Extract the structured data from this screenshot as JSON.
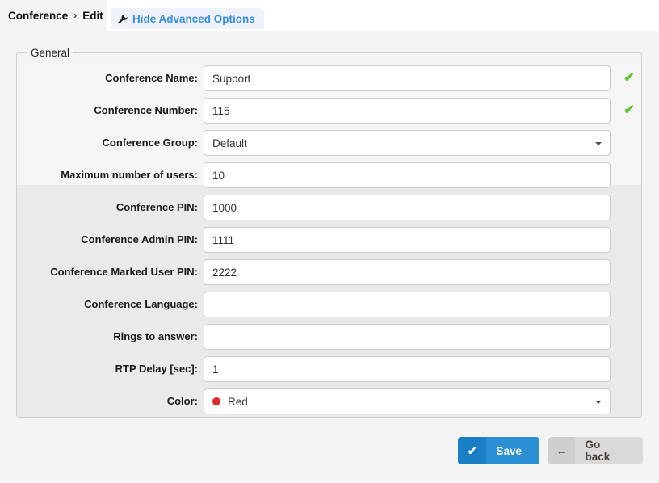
{
  "topbar": {
    "breadcrumb": [
      "Conference",
      "Edit"
    ],
    "breadcrumb_separator": "›",
    "advanced_tab": {
      "label": "Hide Advanced Options",
      "icon": "wrench-icon",
      "color": "#3b8ede",
      "background": "#eef2fb"
    }
  },
  "fieldset": {
    "legend": "General"
  },
  "fields": [
    {
      "label": "Conference Name:",
      "value": "Support",
      "type": "text",
      "valid": true,
      "section": "basic"
    },
    {
      "label": "Conference Number:",
      "value": "115",
      "type": "text",
      "valid": true,
      "section": "basic"
    },
    {
      "label": "Conference Group:",
      "value": "Default",
      "type": "select",
      "valid": false,
      "section": "basic"
    },
    {
      "label": "Maximum number of users:",
      "value": "10",
      "type": "text",
      "valid": false,
      "section": "advanced"
    },
    {
      "label": "Conference PIN:",
      "value": "1000",
      "type": "text",
      "valid": false,
      "section": "advanced"
    },
    {
      "label": "Conference Admin PIN:",
      "value": "1111",
      "type": "text",
      "valid": false,
      "section": "advanced"
    },
    {
      "label": "Conference Marked User PIN:",
      "value": "2222",
      "type": "text",
      "valid": false,
      "section": "advanced"
    },
    {
      "label": "Conference Language:",
      "value": "",
      "type": "text",
      "valid": false,
      "section": "advanced"
    },
    {
      "label": "Rings to answer:",
      "value": "",
      "type": "text",
      "valid": false,
      "section": "advanced"
    },
    {
      "label": "RTP Delay [sec]:",
      "value": "1",
      "type": "text",
      "valid": false,
      "section": "advanced"
    },
    {
      "label": "Color:",
      "value": "Red",
      "type": "select",
      "valid": false,
      "section": "advanced",
      "swatch": "#d92b2b"
    }
  ],
  "validation": {
    "check_glyph": "✔",
    "check_color": "#5cc427"
  },
  "footer": {
    "save": {
      "label": "Save",
      "icon": "check-icon",
      "glyph": "✔",
      "color": "#2b8fd6"
    },
    "go_back": {
      "label": "Go back",
      "icon": "arrow-left-icon",
      "glyph": "←",
      "color": "#d9d9d9"
    }
  }
}
